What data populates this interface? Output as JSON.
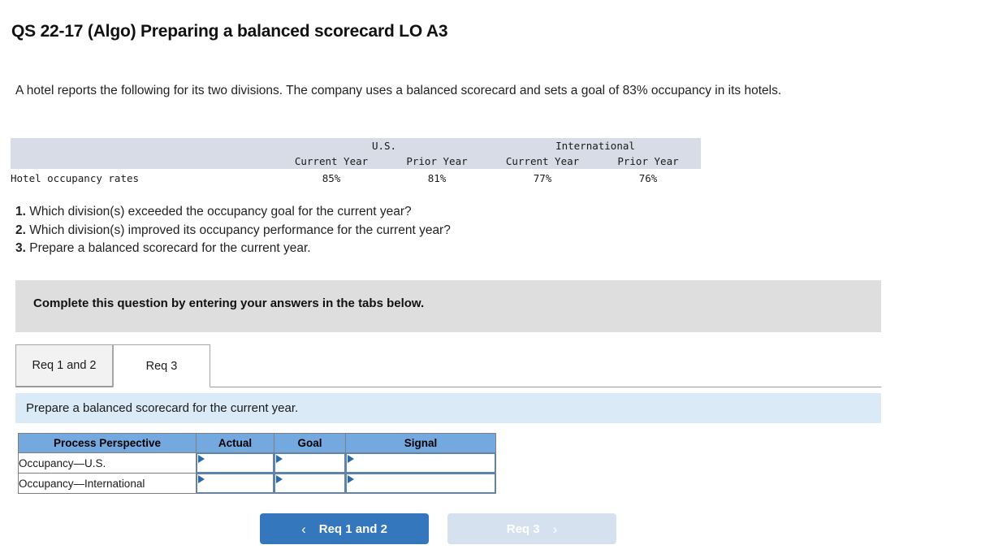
{
  "page_title": "QS 22-17 (Algo) Preparing a balanced scorecard LO A3",
  "intro": "A hotel reports the following for its two divisions. The company uses a balanced scorecard and sets a goal of 83% occupancy in its hotels.",
  "data_table": {
    "group_headers": [
      "",
      "U.S.",
      "International"
    ],
    "column_headers": [
      "",
      "Current Year",
      "Prior Year",
      "Current Year",
      "Prior Year"
    ],
    "rows": [
      {
        "label": "Hotel occupancy rates",
        "values": [
          "85%",
          "81%",
          "77%",
          "76%"
        ]
      }
    ]
  },
  "questions": [
    {
      "number": "1.",
      "text": " Which division(s) exceeded the occupancy goal for the current year?"
    },
    {
      "number": "2.",
      "text": " Which division(s) improved its occupancy performance for the current year?"
    },
    {
      "number": "3.",
      "text": " Prepare a balanced scorecard for the current year."
    }
  ],
  "gray_banner": {
    "text": "Complete this question by entering your answers in the tabs below."
  },
  "tabs": [
    {
      "label": "Req 1 and 2",
      "active": false
    },
    {
      "label": "Req 3",
      "active": true
    }
  ],
  "instruction_bar": {
    "text": "Prepare a balanced scorecard for the current year."
  },
  "scorecard": {
    "headers": [
      "Process Perspective",
      "Actual",
      "Goal",
      "Signal"
    ],
    "rows": [
      {
        "label": "Occupancy—U.S.",
        "actual": "",
        "goal": "",
        "signal": ""
      },
      {
        "label": "Occupancy—International",
        "actual": "",
        "goal": "",
        "signal": ""
      }
    ]
  },
  "nav": {
    "prev_label": "Req 1 and 2",
    "prev_chevron": "‹",
    "next_label": "Req 3",
    "next_chevron": "›"
  },
  "colors": {
    "table_header_blue": "#74a9e0",
    "data_header_gray_blue": "#d7dce6",
    "gray_banner": "#dededf",
    "instruction_blue": "#daeaf7",
    "button_active": "#3577bc",
    "button_disabled": "#d6e1f0",
    "input_border": "#4a86c8"
  }
}
